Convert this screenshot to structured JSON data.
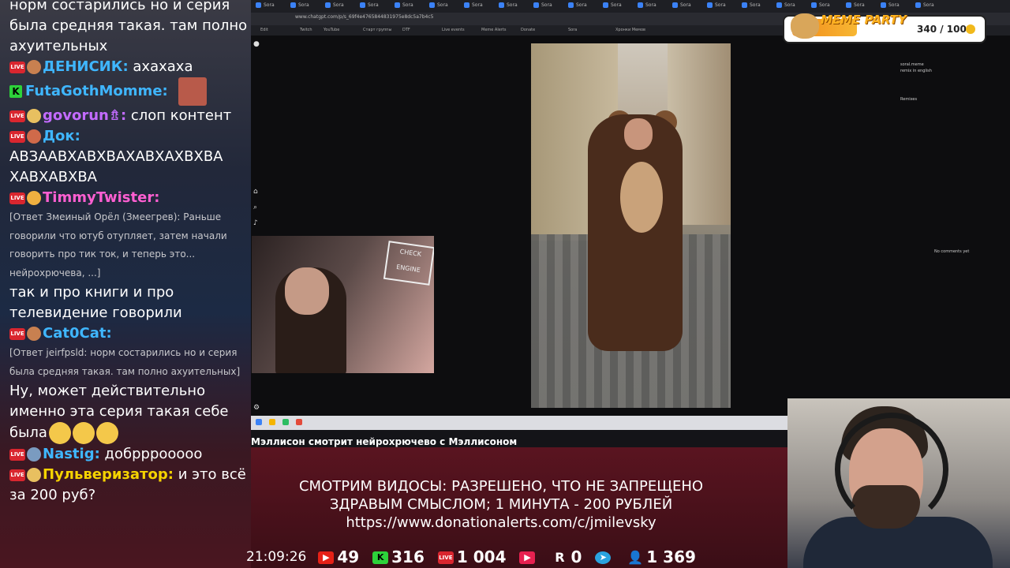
{
  "chat": {
    "messages": [
      {
        "kind": "text",
        "text": "норм состарились но и серия была средняя такая. там полно ахуительных"
      },
      {
        "kind": "msg",
        "platform": "live",
        "name": "ДЕНИСИК:",
        "name_color": "#3fb6ff",
        "text": "ахахаха"
      },
      {
        "kind": "msg",
        "platform": "kick",
        "name": "FutaGothMomme:",
        "name_color": "#3fb6ff",
        "text": ""
      },
      {
        "kind": "msg",
        "platform": "live",
        "name": "govorun⇯:",
        "name_color": "#c36bff",
        "text": "слоп контент"
      },
      {
        "kind": "msg",
        "platform": "live",
        "name": "Док:",
        "name_color": "#3fb6ff",
        "text": "АВЗААВХАВХВАХАВХАХВХВА ХАВХАВХВА"
      },
      {
        "kind": "msg",
        "platform": "live",
        "name": "TimmyTwister:",
        "name_color": "#ff5fd2",
        "quote": "[Ответ Змеиный Орёл (Змеегрев): Раньше говорили что ютуб отупляет, затем начали говорить про тик ток, и теперь это... нейрохрючева, ...]",
        "text": "так и про книги и про телевидение говорили"
      },
      {
        "kind": "msg",
        "platform": "live",
        "name": "Cat0Cat:",
        "name_color": "#3fb6ff",
        "quote": "[Ответ jeirfpsld: норм состарились но и серия была средняя такая. там полно ахуительных]",
        "text": "Ну, может действительно именно эта серия такая себе была"
      },
      {
        "kind": "msg",
        "platform": "live",
        "name": "Nastig:",
        "name_color": "#3fb6ff",
        "text": "добрррооооо"
      },
      {
        "kind": "msg",
        "platform": "live",
        "name": "Пульверизатор:",
        "name_color": "#f5d300",
        "text": "и это всё за 200 руб?"
      }
    ]
  },
  "browser": {
    "url": "www.chatgpt.com/p/s_69f4e4765844831975e8dc5a7b4c5",
    "tabs": [
      "Sora",
      "Sora",
      "Sora",
      "Sora",
      "Sora",
      "Sora",
      "Sora",
      "Sora",
      "Sora",
      "Sora",
      "Sora",
      "Sora",
      "Sora",
      "Sora",
      "Sora",
      "Sora",
      "Sora",
      "Sora",
      "Sora",
      "Sora"
    ],
    "bookmarks": [
      "Edit",
      "Twitch",
      "YouTube",
      "Старт группы",
      "DTF",
      "Live events",
      "Meme Alerts",
      "Donate",
      "Sora",
      "Хронки Мемов"
    ],
    "side_text": "soral.meme",
    "remix_text": "remix in english",
    "remixes_label": "Remixes",
    "no_comments": "No comments yet"
  },
  "stream_title": "Мэллисон смотрит нейрохрючево с Мэллисоном",
  "rules": {
    "line1": "СМОТРИМ ВИДОСЫ: РАЗРЕШЕНО, ЧТО НЕ ЗАПРЕЩЕНО",
    "line2": "ЗДРАВЫМ СМЫСЛОМ; 1 МИНУТА - 200 РУБЛЕЙ",
    "url": "https://www.donationalerts.com/c/jmilevsky"
  },
  "stats": {
    "clock": "21:09:26",
    "youtube": "49",
    "kick": "316",
    "vklive": "1 004",
    "rutube": "0",
    "telegram": "",
    "viewers": "1 369"
  },
  "meme_party": {
    "title": "MEME PARTY",
    "score": "340 / 1000"
  },
  "pip": {
    "sign": "CHECK ENGINE"
  },
  "colors": {
    "live_badge": "#d9262f",
    "kick": "#2dd23a",
    "overlay": "#5a1420"
  }
}
